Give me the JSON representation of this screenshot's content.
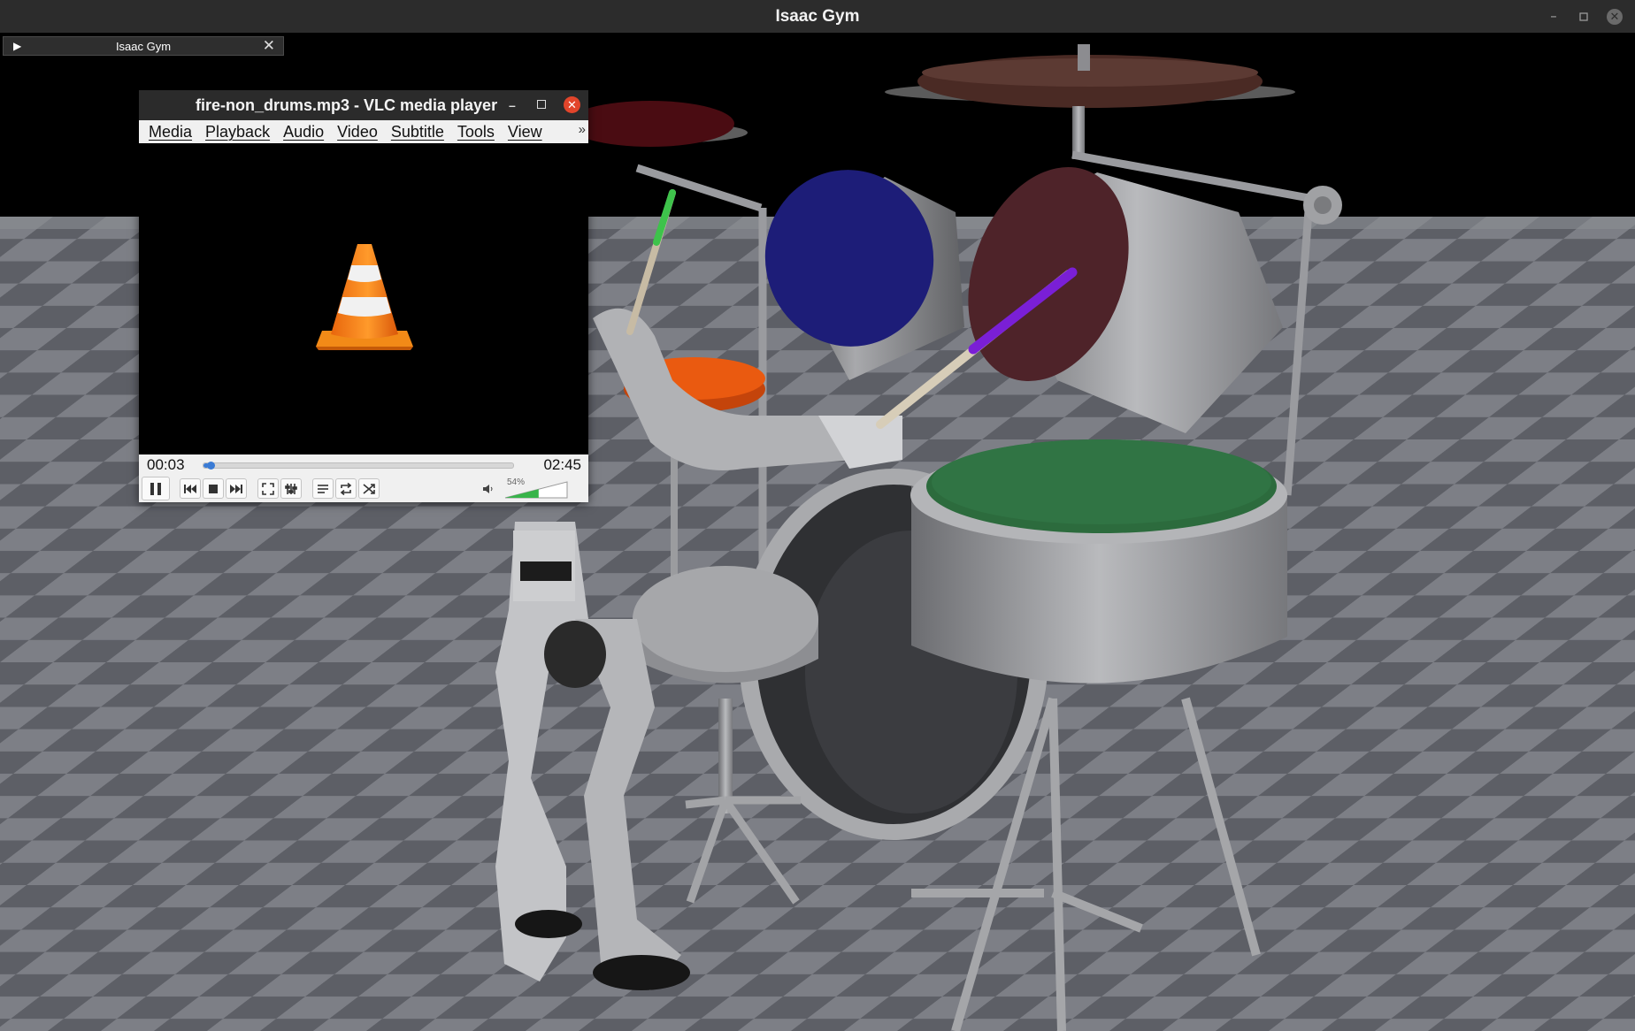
{
  "window": {
    "title": "Isaac Gym",
    "controls": [
      "minimize-icon",
      "maximize-icon",
      "close-icon"
    ]
  },
  "gym_panel": {
    "label": "Isaac Gym",
    "expand_icon": "play-triangle-icon",
    "close_icon": "close-icon"
  },
  "vlc": {
    "title": "fire-non_drums.mp3 - VLC media player",
    "menu": [
      "Media",
      "Playback",
      "Audio",
      "Video",
      "Subtitle",
      "Tools",
      "View"
    ],
    "menu_more": "»",
    "time_elapsed": "00:03",
    "time_total": "02:45",
    "progress": 0.018,
    "volume_label": "54%",
    "volume": 0.54,
    "accent_color": "#3a7bd5",
    "controls": [
      "pause-icon",
      "previous-icon",
      "stop-icon",
      "next-icon",
      "fullscreen-icon",
      "extended-settings-icon",
      "playlist-icon",
      "loop-icon",
      "shuffle-icon",
      "volume-icon"
    ]
  },
  "scene": {
    "description_icons": [
      "humanoid-robot",
      "drum-kit",
      "checkerboard-floor"
    ]
  }
}
